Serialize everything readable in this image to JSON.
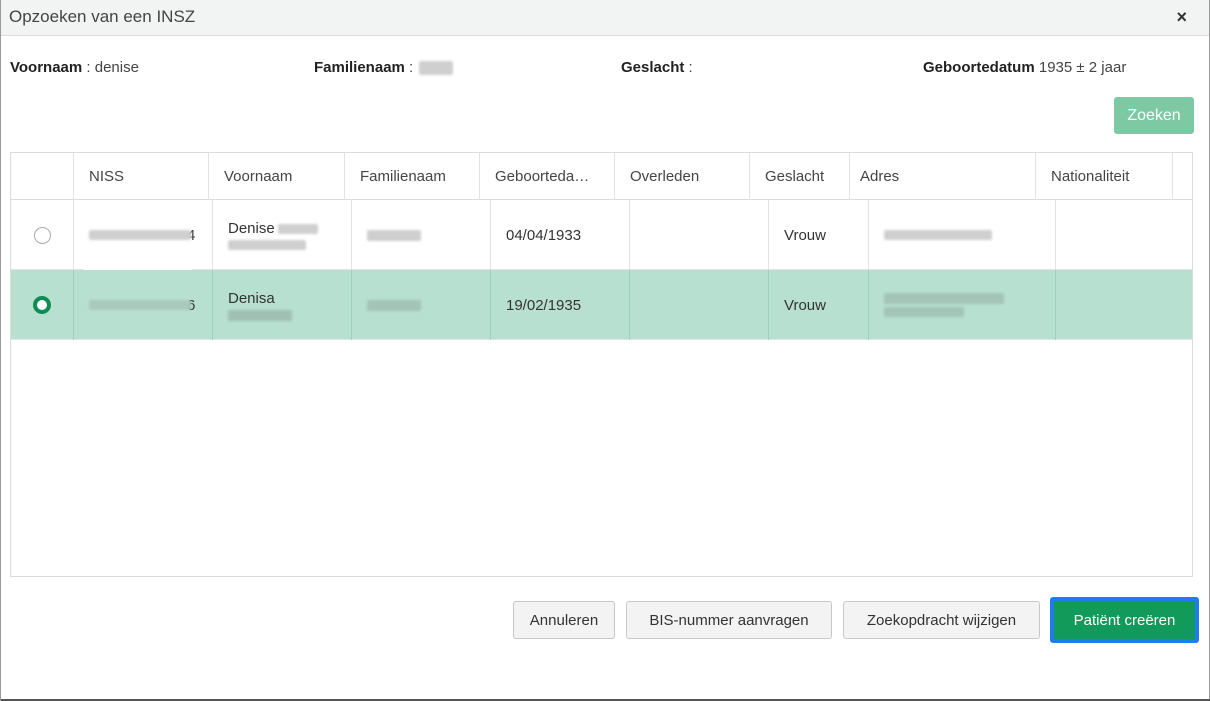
{
  "dialog": {
    "title": "Opzoeken van een INSZ",
    "close_label": "×"
  },
  "criteria": {
    "firstname_label": "Voornaam",
    "firstname_value": " : denise",
    "lastname_label": "Familienaam",
    "lastname_value": " : ",
    "gender_label": "Geslacht",
    "gender_value": " :",
    "birthdate_label": "Geboortedatum",
    "birthdate_value": " 1935 ± 2 jaar"
  },
  "search_button": "Zoeken",
  "table": {
    "columns": [
      "",
      "NISS",
      "Voornaam",
      "Familienaam",
      "Geboorteda…",
      "Overleden",
      "Geslacht",
      "Adres",
      "Nationaliteit"
    ],
    "rows": [
      {
        "selected": false,
        "niss": "4",
        "firstname": "Denise",
        "lastname": "",
        "birthdate": "04/04/1933",
        "deceased": "",
        "gender": "Vrouw",
        "address": "",
        "nationality": ""
      },
      {
        "selected": true,
        "niss": "6",
        "firstname": "Denisa",
        "lastname": "",
        "birthdate": "19/02/1935",
        "deceased": "",
        "gender": "Vrouw",
        "address": "",
        "nationality": ""
      }
    ]
  },
  "footer": {
    "cancel": "Annuleren",
    "bis": "BIS-nummer aanvragen",
    "modify": "Zoekopdracht wijzigen",
    "create": "Patiënt creëren"
  },
  "colors": {
    "accent_green": "#129a5b",
    "selected_row": "#b8e0d1",
    "search_button": "#7cc9a3",
    "focus_ring": "#1e7cf0"
  }
}
